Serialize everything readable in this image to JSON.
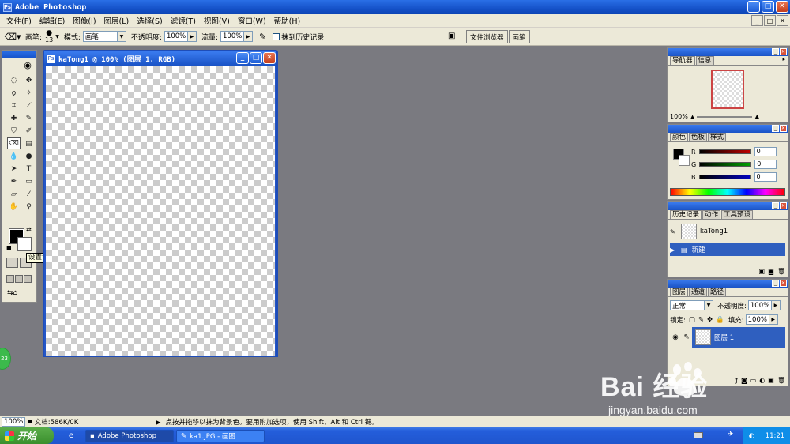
{
  "app": {
    "title": "Adobe Photoshop",
    "icon": "Ps"
  },
  "window_buttons": {
    "minimize": "_",
    "maximize": "□",
    "close": "✕"
  },
  "menu": [
    "文件(F)",
    "编辑(E)",
    "图像(I)",
    "图层(L)",
    "选择(S)",
    "滤镜(T)",
    "视图(V)",
    "窗口(W)",
    "帮助(H)"
  ],
  "options": {
    "brush_label": "画笔:",
    "brush_size": "13",
    "mode_label": "模式:",
    "mode_value": "画笔",
    "opacity_label": "不透明度:",
    "opacity_value": "100%",
    "flow_label": "流量:",
    "flow_value": "100%",
    "erase_history_label": "抹到历史记录",
    "well_tabs": [
      "文件浏览器",
      "画笔"
    ]
  },
  "toolbox": {
    "tooltip": "设置背景色"
  },
  "document": {
    "title": "kaTong1 @ 100% (图层 1, RGB)"
  },
  "navigator": {
    "tabs": [
      "导航器",
      "信息"
    ],
    "zoom": "100%"
  },
  "color_panel": {
    "tabs": [
      "颜色",
      "色板",
      "样式"
    ],
    "channels": [
      {
        "label": "R",
        "value": "0",
        "color": "#c00000"
      },
      {
        "label": "G",
        "value": "0",
        "color": "#00a000"
      },
      {
        "label": "B",
        "value": "0",
        "color": "#0000c0"
      }
    ]
  },
  "history_panel": {
    "tabs": [
      "历史记录",
      "动作",
      "工具预设"
    ],
    "snapshot": "kaTong1",
    "states": [
      "新建"
    ]
  },
  "layers_panel": {
    "tabs": [
      "图层",
      "通道",
      "路径"
    ],
    "blend_mode": "正常",
    "opacity_label": "不透明度:",
    "opacity_value": "100%",
    "lock_label": "锁定:",
    "fill_label": "填充:",
    "fill_value": "100%",
    "layers": [
      "图层 1"
    ]
  },
  "status": {
    "zoom": "100%",
    "doc_info": "文档:586K/0K",
    "hint": "点按并拖移以抹为背景色。要用附加选项，使用 Shift、Alt 和 Ctrl 键。"
  },
  "taskbar": {
    "start": "开始",
    "tasks": [
      "Adobe Photoshop",
      "ka1.JPG - 画图"
    ],
    "clock": "11:21"
  },
  "overlay": {
    "badge": "23",
    "watermark": "Bai 经验",
    "watermark_url": "jingyan.baidu.com"
  }
}
